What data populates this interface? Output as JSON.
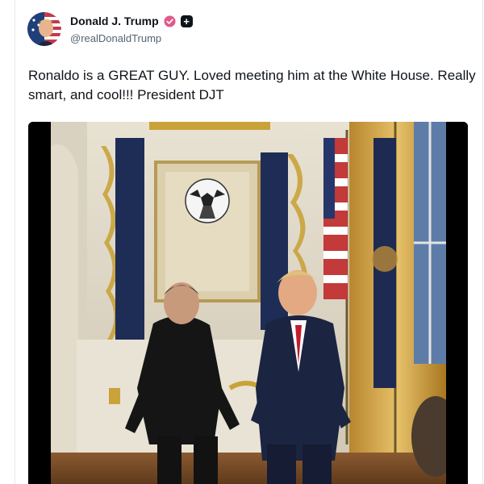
{
  "post": {
    "author": {
      "display_name": "Donald J. Trump",
      "handle": "@realDonaldTrump",
      "verified_icon": "verified-badge-icon",
      "plus_icon": "plus-square-icon"
    },
    "text": "Ronaldo is a GREAT GUY. Loved meeting him at the White House. Really smart, and cool!!! President DJT",
    "media": {
      "type": "video"
    }
  },
  "colors": {
    "verified_badge": "#e05a8a",
    "handle_text": "#536471",
    "text": "#0f1419"
  }
}
